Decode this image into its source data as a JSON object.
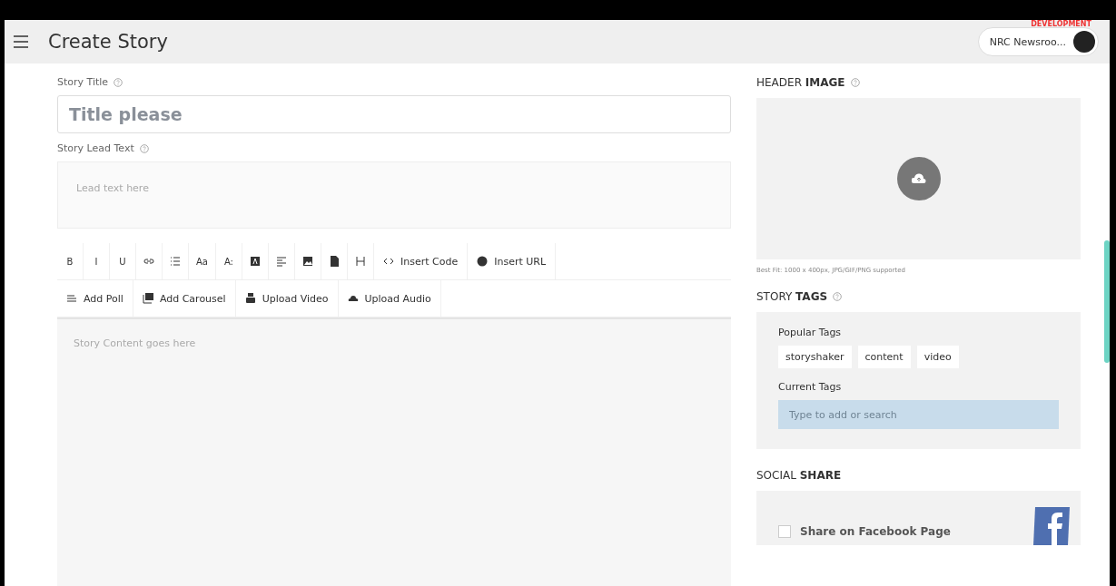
{
  "header": {
    "title": "Create Story",
    "badge": "DEVELOPMENT",
    "account": "NRC Newsroo..."
  },
  "form": {
    "title_label": "Story Title",
    "title_placeholder": "Title please",
    "lead_label": "Story Lead Text",
    "lead_placeholder": "Lead text here",
    "content_placeholder": "Story Content goes here"
  },
  "toolbar": {
    "main": [
      {
        "kind": "letter",
        "label": "B"
      },
      {
        "kind": "letter",
        "label": "I"
      },
      {
        "kind": "letter",
        "label": "U"
      },
      {
        "kind": "icon"
      },
      {
        "kind": "icon"
      },
      {
        "kind": "letter",
        "label": "Aa"
      },
      {
        "kind": "letter",
        "label": "A:"
      },
      {
        "kind": "icon"
      },
      {
        "kind": "icon"
      },
      {
        "kind": "icon"
      },
      {
        "kind": "icon"
      },
      {
        "kind": "icon"
      },
      {
        "kind": "labeled",
        "label": "Insert Code"
      },
      {
        "kind": "labeled",
        "label": "Insert URL"
      }
    ],
    "media": [
      {
        "kind": "labeled",
        "label": "Add Poll"
      },
      {
        "kind": "labeled",
        "label": "Add Carousel"
      },
      {
        "kind": "labeled",
        "label": "Upload Video"
      },
      {
        "kind": "labeled",
        "label": "Upload Audio"
      }
    ]
  },
  "header_image": {
    "title": "HEADER **IMAGE**",
    "hint": "Best Fit: 1000 x 400px, JPG/GIF/PNG supported"
  },
  "tags": {
    "title": "STORY **TAGS**",
    "popular_label": "Popular Tags",
    "popular": [
      "storyshaker",
      "content",
      "video"
    ],
    "current_label": "Current Tags",
    "placeholder": "Type to add or search"
  },
  "social": {
    "title": "SOCIAL **SHARE**",
    "facebook_label": "Share on Facebook Page",
    "checked": false
  }
}
